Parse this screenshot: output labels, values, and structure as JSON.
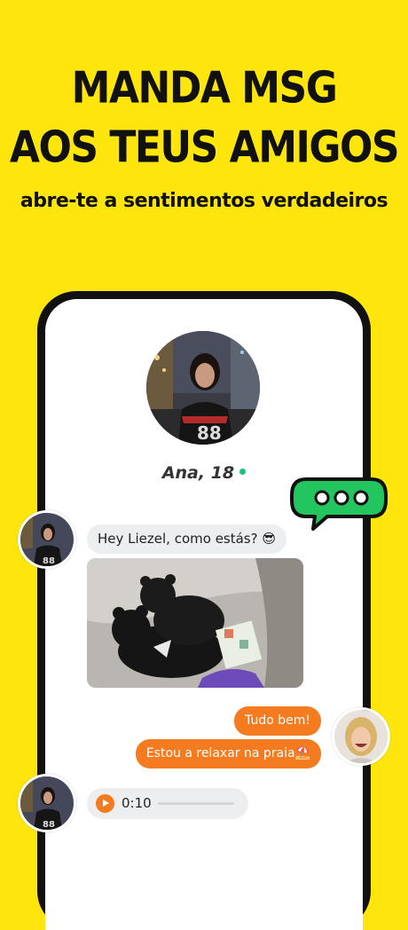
{
  "hero": {
    "line1": "MANDA MSG",
    "line2": "AOS TEUS AMIGOS",
    "subtitle": "abre-te a sentimentos verdadeiros"
  },
  "chat": {
    "contact_name": "Ana, 18",
    "online": true,
    "messages": [
      {
        "type": "text",
        "direction": "incoming",
        "text": "Hey Liezel, como estás? 😎"
      },
      {
        "type": "photo",
        "direction": "incoming"
      },
      {
        "type": "text",
        "direction": "outgoing",
        "text": "Tudo bem!"
      },
      {
        "type": "text",
        "direction": "outgoing",
        "text": "Estou a relaxar na praia⛱️"
      },
      {
        "type": "voice",
        "direction": "incoming",
        "duration": "0:10",
        "progress": 0
      }
    ]
  },
  "colors": {
    "background": "#FEE50C",
    "accent": "#F47B20",
    "online": "#19C37D",
    "typing_bubble": "#22C55E"
  },
  "icons": {
    "typing": "typing-indicator-icon",
    "play": "play-icon"
  }
}
